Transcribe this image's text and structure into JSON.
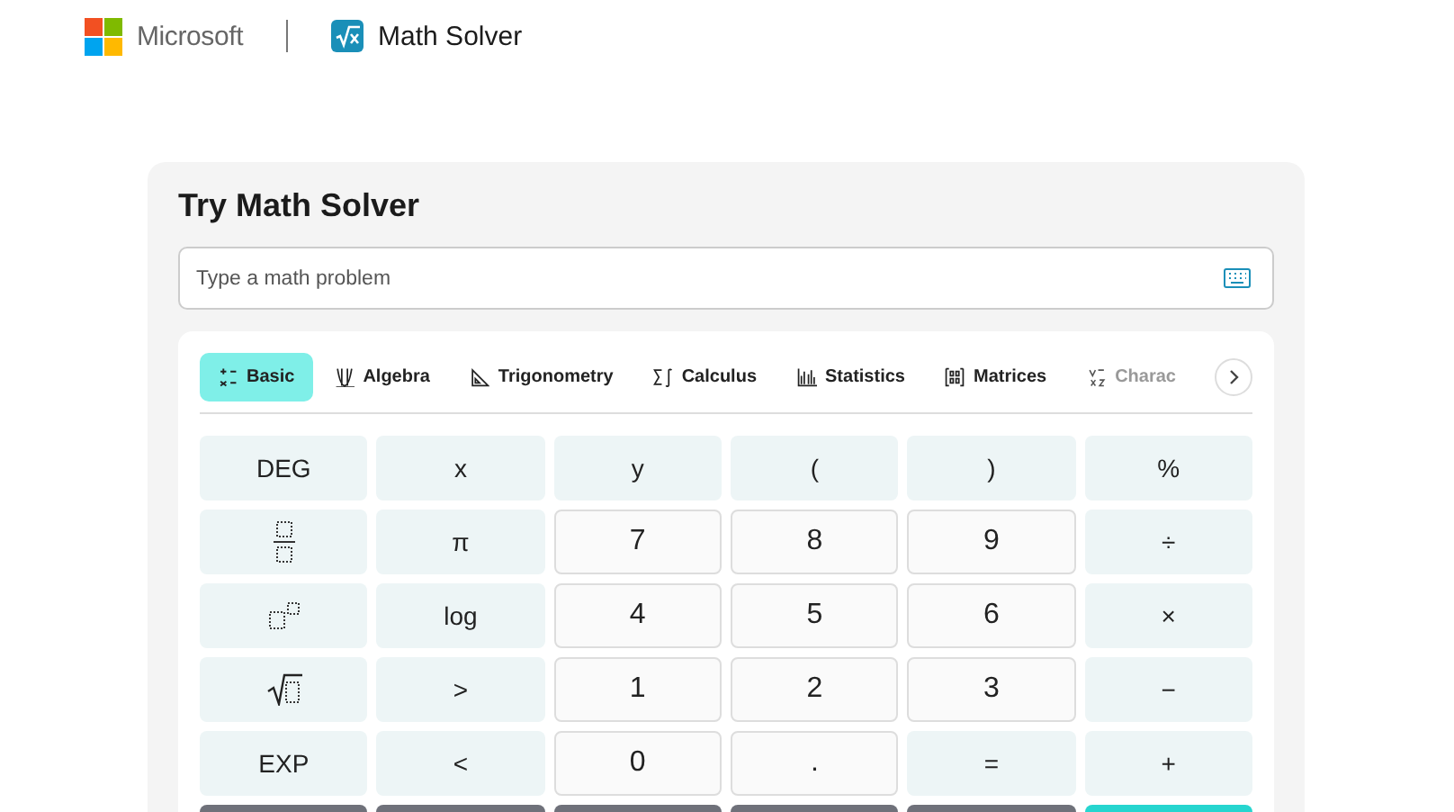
{
  "header": {
    "brand": "Microsoft",
    "product": "Math Solver"
  },
  "card": {
    "title": "Try Math Solver",
    "input": {
      "placeholder": "Type a math problem"
    }
  },
  "tabs": [
    {
      "label": "Basic",
      "selected": true
    },
    {
      "label": "Algebra",
      "selected": false
    },
    {
      "label": "Trigonometry",
      "selected": false
    },
    {
      "label": "Calculus",
      "selected": false
    },
    {
      "label": "Statistics",
      "selected": false
    },
    {
      "label": "Matrices",
      "selected": false
    },
    {
      "label": "Charac",
      "selected": false
    }
  ],
  "keys": [
    {
      "kind": "function",
      "label": "DEG"
    },
    {
      "kind": "function",
      "label": "x"
    },
    {
      "kind": "function",
      "label": "y"
    },
    {
      "kind": "function",
      "label": "("
    },
    {
      "kind": "function",
      "label": ")"
    },
    {
      "kind": "function",
      "label": "%"
    },
    {
      "kind": "fraction"
    },
    {
      "kind": "function",
      "label": "π"
    },
    {
      "kind": "digit",
      "label": "7"
    },
    {
      "kind": "digit",
      "label": "8"
    },
    {
      "kind": "digit",
      "label": "9"
    },
    {
      "kind": "function",
      "label": "÷"
    },
    {
      "kind": "power"
    },
    {
      "kind": "function",
      "label": "log"
    },
    {
      "kind": "digit",
      "label": "4"
    },
    {
      "kind": "digit",
      "label": "5"
    },
    {
      "kind": "digit",
      "label": "6"
    },
    {
      "kind": "function",
      "label": "×"
    },
    {
      "kind": "sqrt"
    },
    {
      "kind": "function",
      "label": ">"
    },
    {
      "kind": "digit",
      "label": "1"
    },
    {
      "kind": "digit",
      "label": "2"
    },
    {
      "kind": "digit",
      "label": "3"
    },
    {
      "kind": "function",
      "label": "−"
    },
    {
      "kind": "function",
      "label": "EXP"
    },
    {
      "kind": "function",
      "label": "<"
    },
    {
      "kind": "digit",
      "label": "0"
    },
    {
      "kind": "digit",
      "label": "."
    },
    {
      "kind": "function",
      "label": "="
    },
    {
      "kind": "function",
      "label": "+"
    },
    {
      "kind": "dark"
    },
    {
      "kind": "dark"
    },
    {
      "kind": "dark"
    },
    {
      "kind": "dark"
    },
    {
      "kind": "dark"
    },
    {
      "kind": "accent"
    }
  ]
}
